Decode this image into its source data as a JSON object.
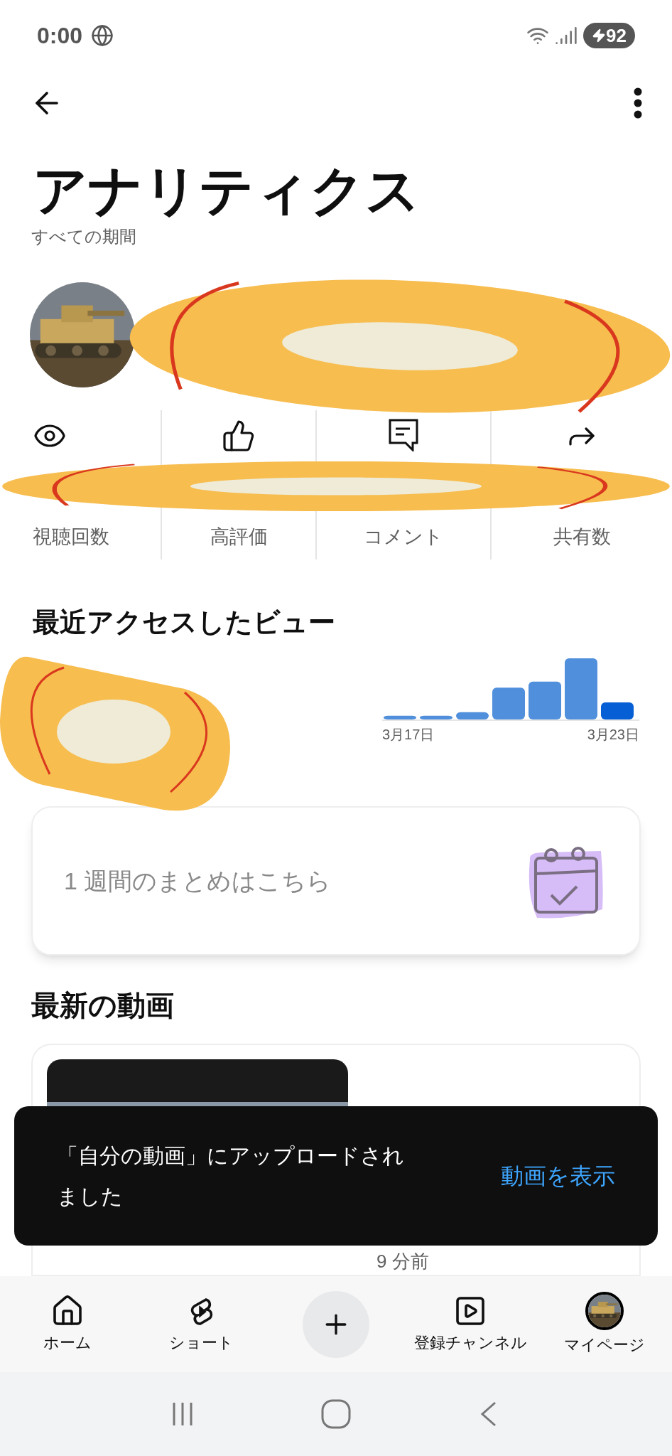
{
  "status_bar": {
    "time": "0:00",
    "battery": "92"
  },
  "title": "アナリティクス",
  "subtitle": "すべての期間",
  "stats": [
    {
      "kind": "views",
      "label": "視聴回数"
    },
    {
      "kind": "likes",
      "label": "高評価"
    },
    {
      "kind": "comments",
      "label": "コメント"
    },
    {
      "kind": "shares",
      "label": "共有数"
    }
  ],
  "recent": {
    "heading": "最近アクセスしたビュー",
    "axis_labels": [
      "3月17日",
      "3月23日"
    ]
  },
  "summary_card": {
    "text": "1 週間のまとめはこちら"
  },
  "latest": {
    "heading": "最新の動画",
    "video": {
      "time_ago": "9 分前"
    }
  },
  "toast": {
    "message": "「自分の動画」にアップロードされました",
    "action": "動画を表示"
  },
  "nav": [
    {
      "kind": "home",
      "label": "ホーム"
    },
    {
      "kind": "shorts",
      "label": "ショート"
    },
    {
      "kind": "create"
    },
    {
      "kind": "subscriptions",
      "label": "登録チャンネル"
    },
    {
      "kind": "profile",
      "label": "マイページ"
    }
  ]
}
